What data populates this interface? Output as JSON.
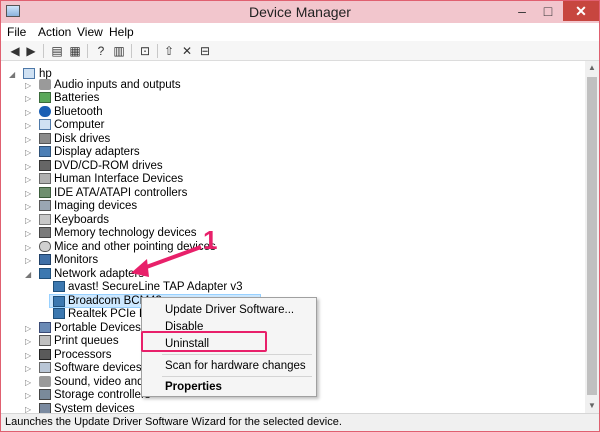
{
  "window": {
    "title": "Device Manager"
  },
  "menu": [
    "File",
    "Action",
    "View",
    "Help"
  ],
  "tree": {
    "root": "hp",
    "categories": [
      {
        "label": "Audio inputs and outputs",
        "icon": "speaker-icon"
      },
      {
        "label": "Batteries",
        "icon": "battery-icon"
      },
      {
        "label": "Bluetooth",
        "icon": "bluetooth-icon"
      },
      {
        "label": "Computer",
        "icon": "computer-icon"
      },
      {
        "label": "Disk drives",
        "icon": "disk-drive-icon"
      },
      {
        "label": "Display adapters",
        "icon": "display-adapter-icon"
      },
      {
        "label": "DVD/CD-ROM drives",
        "icon": "dvd-drive-icon"
      },
      {
        "label": "Human Interface Devices",
        "icon": "hid-icon"
      },
      {
        "label": "IDE ATA/ATAPI controllers",
        "icon": "ide-controller-icon"
      },
      {
        "label": "Imaging devices",
        "icon": "camera-icon"
      },
      {
        "label": "Keyboards",
        "icon": "keyboard-icon"
      },
      {
        "label": "Memory technology devices",
        "icon": "memory-icon"
      },
      {
        "label": "Mice and other pointing devices",
        "icon": "mouse-icon"
      },
      {
        "label": "Monitors",
        "icon": "monitor-icon"
      }
    ],
    "network": {
      "label": "Network adapters",
      "children": [
        "avast! SecureLine TAP Adapter v3",
        "Broadcom BCM43",
        "Realtek PCIe FE Fa"
      ]
    },
    "after": [
      {
        "label": "Portable Devices",
        "icon": "portable-device-icon"
      },
      {
        "label": "Print queues",
        "icon": "printer-icon"
      },
      {
        "label": "Processors",
        "icon": "processor-icon"
      },
      {
        "label": "Software devices",
        "icon": "software-device-icon"
      },
      {
        "label": "Sound, video and gar",
        "icon": "sound-icon"
      },
      {
        "label": "Storage controllers",
        "icon": "storage-icon"
      },
      {
        "label": "System devices",
        "icon": "system-device-icon"
      }
    ]
  },
  "context_menu": {
    "update": "Update Driver Software...",
    "disable": "Disable",
    "uninstall": "Uninstall",
    "scan": "Scan for hardware changes",
    "properties": "Properties"
  },
  "annotation": {
    "number": "1",
    "color": "#e8206a"
  },
  "status": "Launches the Update Driver Software Wizard for the selected device."
}
